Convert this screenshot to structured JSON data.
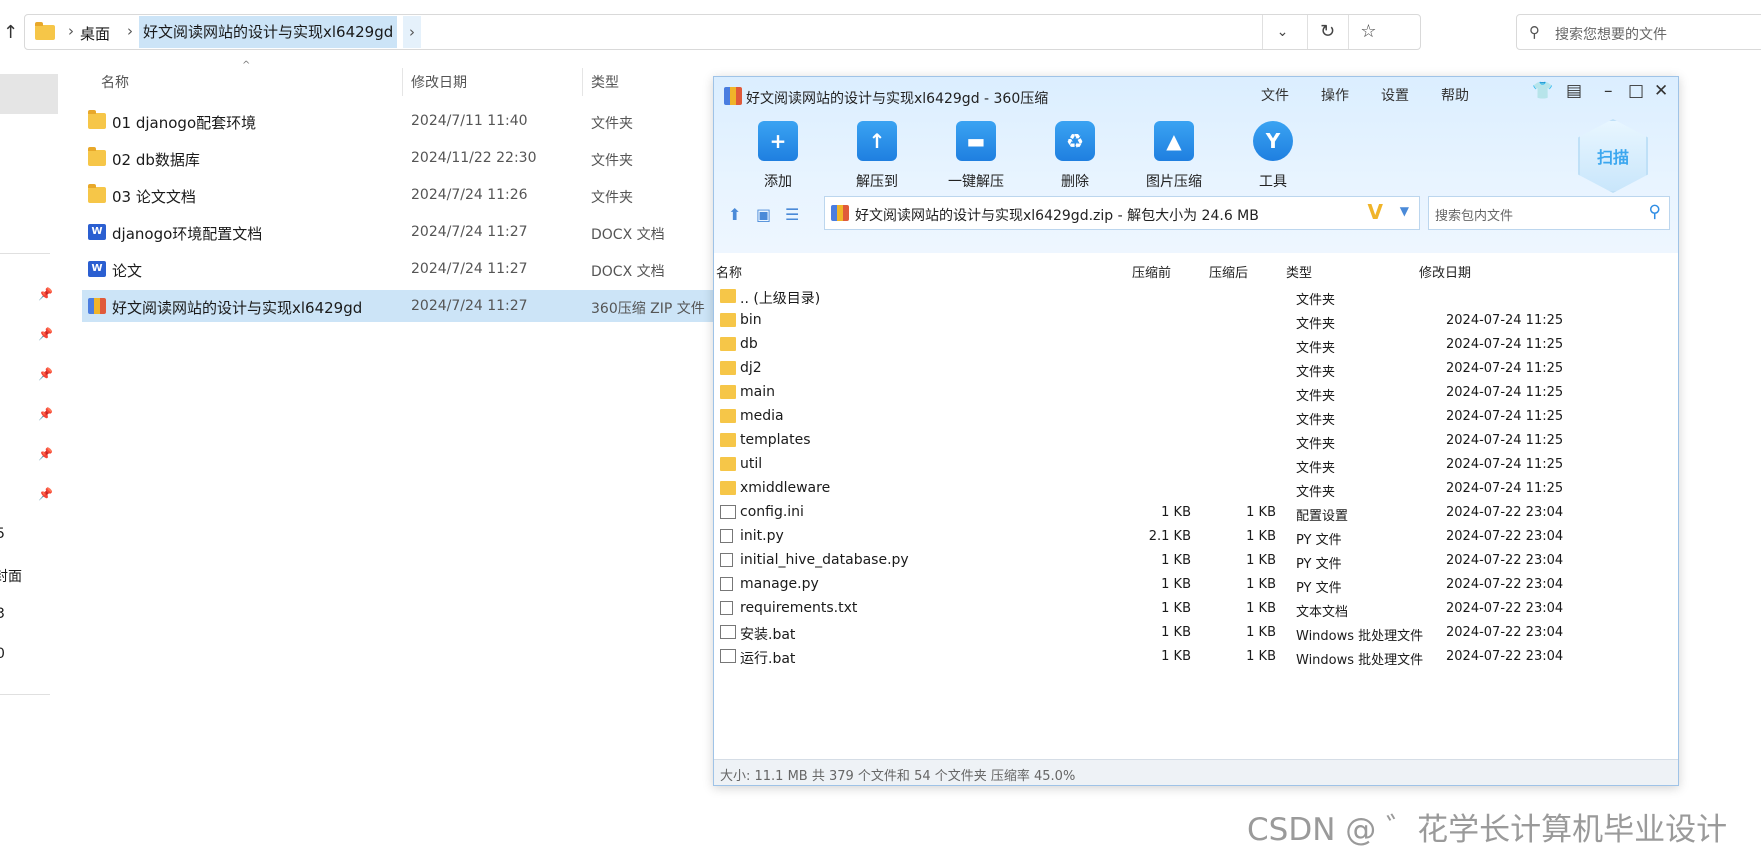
{
  "explorer": {
    "address": {
      "crumbs": [
        "桌面",
        "好文阅读网站的设计与实现xl6429gd"
      ],
      "search_placeholder": "搜索您想要的文件"
    },
    "nav_fragments": [
      "5",
      "封面",
      "3",
      "0"
    ],
    "columns": {
      "name": "名称",
      "date": "修改日期",
      "type": "类型"
    },
    "files": [
      {
        "name": "01 djanogo配套环境",
        "date": "2024/7/11 11:40",
        "type": "文件夹",
        "icon": "folder-icon"
      },
      {
        "name": "02 db数据库",
        "date": "2024/11/22 22:30",
        "type": "文件夹",
        "icon": "folder-icon"
      },
      {
        "name": "03 论文文档",
        "date": "2024/7/24 11:26",
        "type": "文件夹",
        "icon": "folder-icon"
      },
      {
        "name": "djanogo环境配置文档",
        "date": "2024/7/24 11:27",
        "type": "DOCX 文档",
        "icon": "word-doc-icon"
      },
      {
        "name": "论文",
        "date": "2024/7/24 11:27",
        "type": "DOCX 文档",
        "icon": "word-doc-icon"
      },
      {
        "name": "好文阅读网站的设计与实现xl6429gd",
        "date": "2024/7/24 11:27",
        "type": "360压缩 ZIP 文件",
        "icon": "zip-archive-icon",
        "selected": true
      }
    ]
  },
  "zip": {
    "title": "好文阅读网站的设计与实现xl6429gd - 360压缩",
    "menu": [
      "文件",
      "操作",
      "设置",
      "帮助"
    ],
    "toolbar": [
      "添加",
      "解压到",
      "一键解压",
      "删除",
      "图片压缩",
      "工具"
    ],
    "scan_label": "扫描",
    "path_text": "好文阅读网站的设计与实现xl6429gd.zip - 解包大小为 24.6 MB",
    "search_placeholder": "搜索包内文件",
    "columns": {
      "name": "名称",
      "before": "压缩前",
      "after": "压缩后",
      "type": "类型",
      "date": "修改日期"
    },
    "rows": [
      {
        "name": ".. (上级目录)",
        "before": "",
        "after": "",
        "type": "文件夹",
        "date": "",
        "kind": "folder"
      },
      {
        "name": "bin",
        "before": "",
        "after": "",
        "type": "文件夹",
        "date": "2024-07-24 11:25",
        "kind": "folder"
      },
      {
        "name": "db",
        "before": "",
        "after": "",
        "type": "文件夹",
        "date": "2024-07-24 11:25",
        "kind": "folder"
      },
      {
        "name": "dj2",
        "before": "",
        "after": "",
        "type": "文件夹",
        "date": "2024-07-24 11:25",
        "kind": "folder"
      },
      {
        "name": "main",
        "before": "",
        "after": "",
        "type": "文件夹",
        "date": "2024-07-24 11:25",
        "kind": "folder"
      },
      {
        "name": "media",
        "before": "",
        "after": "",
        "type": "文件夹",
        "date": "2024-07-24 11:25",
        "kind": "folder"
      },
      {
        "name": "templates",
        "before": "",
        "after": "",
        "type": "文件夹",
        "date": "2024-07-24 11:25",
        "kind": "folder"
      },
      {
        "name": "util",
        "before": "",
        "after": "",
        "type": "文件夹",
        "date": "2024-07-24 11:25",
        "kind": "folder"
      },
      {
        "name": "xmiddleware",
        "before": "",
        "after": "",
        "type": "文件夹",
        "date": "2024-07-24 11:25",
        "kind": "folder"
      },
      {
        "name": "config.ini",
        "before": "1 KB",
        "after": "1 KB",
        "type": "配置设置",
        "date": "2024-07-22 23:04",
        "kind": "config"
      },
      {
        "name": "init.py",
        "before": "2.1 KB",
        "after": "1 KB",
        "type": "PY 文件",
        "date": "2024-07-22 23:04",
        "kind": "file"
      },
      {
        "name": "initial_hive_database.py",
        "before": "1 KB",
        "after": "1 KB",
        "type": "PY 文件",
        "date": "2024-07-22 23:04",
        "kind": "file"
      },
      {
        "name": "manage.py",
        "before": "1 KB",
        "after": "1 KB",
        "type": "PY 文件",
        "date": "2024-07-22 23:04",
        "kind": "file"
      },
      {
        "name": "requirements.txt",
        "before": "1 KB",
        "after": "1 KB",
        "type": "文本文档",
        "date": "2024-07-22 23:04",
        "kind": "file"
      },
      {
        "name": "安装.bat",
        "before": "1 KB",
        "after": "1 KB",
        "type": "Windows 批处理文件",
        "date": "2024-07-22 23:04",
        "kind": "config"
      },
      {
        "name": "运行.bat",
        "before": "1 KB",
        "after": "1 KB",
        "type": "Windows 批处理文件",
        "date": "2024-07-22 23:04",
        "kind": "config"
      }
    ],
    "status": "大小: 11.1 MB 共 379 个文件和 54 个文件夹 压缩率 45.0%"
  },
  "watermark": "CSDN @ ゛花学长计算机毕业设计",
  "colors": {
    "selection": "#cce4f7",
    "folder": "#f6c648",
    "zip_header": "#dbeeff",
    "accent": "#1f7fe0"
  }
}
